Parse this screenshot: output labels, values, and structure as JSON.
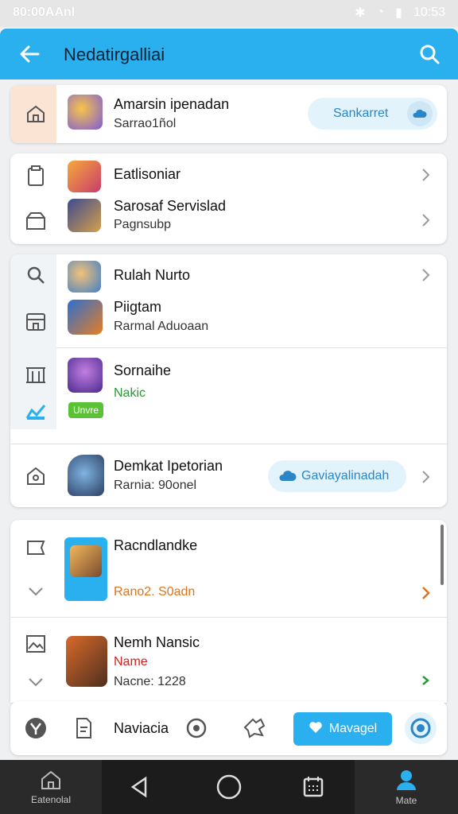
{
  "status": {
    "time": "80:00AAnl",
    "clock": "10:53"
  },
  "appbar": {
    "title": "Nedatirgalliai"
  },
  "card1": {
    "title": "Amarsin ipenadan",
    "subtitle": "Sarrao1ñol",
    "pill": "Sankarret"
  },
  "card2": {
    "items": [
      {
        "title": "Eatlisoniar",
        "subtitle": ""
      },
      {
        "title": "Sarosaf Servislad",
        "subtitle": "Pagnsubp"
      }
    ]
  },
  "card3": {
    "items": [
      {
        "title": "Rulah Nurto"
      },
      {
        "title": "Piigtam",
        "subtitle": "Rarmal Aduoaan"
      },
      {
        "title": "Sornaihe",
        "subtitle": "Nakic",
        "badge": "Unvre"
      },
      {
        "title": "Demkat Ipetorian",
        "subtitle": "Rarnia: 90onel",
        "pill": "Gaviayalinadah"
      }
    ]
  },
  "card4": {
    "items": [
      {
        "title": "Racndlandke",
        "subtitle": "Rano2. S0adn"
      },
      {
        "title": "Nemh Nansic",
        "subtitle_red": "Name",
        "subtitle": "Nacne: 1228"
      }
    ]
  },
  "bottombar": {
    "label": "Naviacia",
    "manage": "Mavagel"
  },
  "navbar": {
    "home": "Eatenolal",
    "profile": "Mate"
  },
  "colors": {
    "accent": "#2ab0ef",
    "green": "#5bc236",
    "orange": "#e0731c",
    "red": "#d12020"
  }
}
